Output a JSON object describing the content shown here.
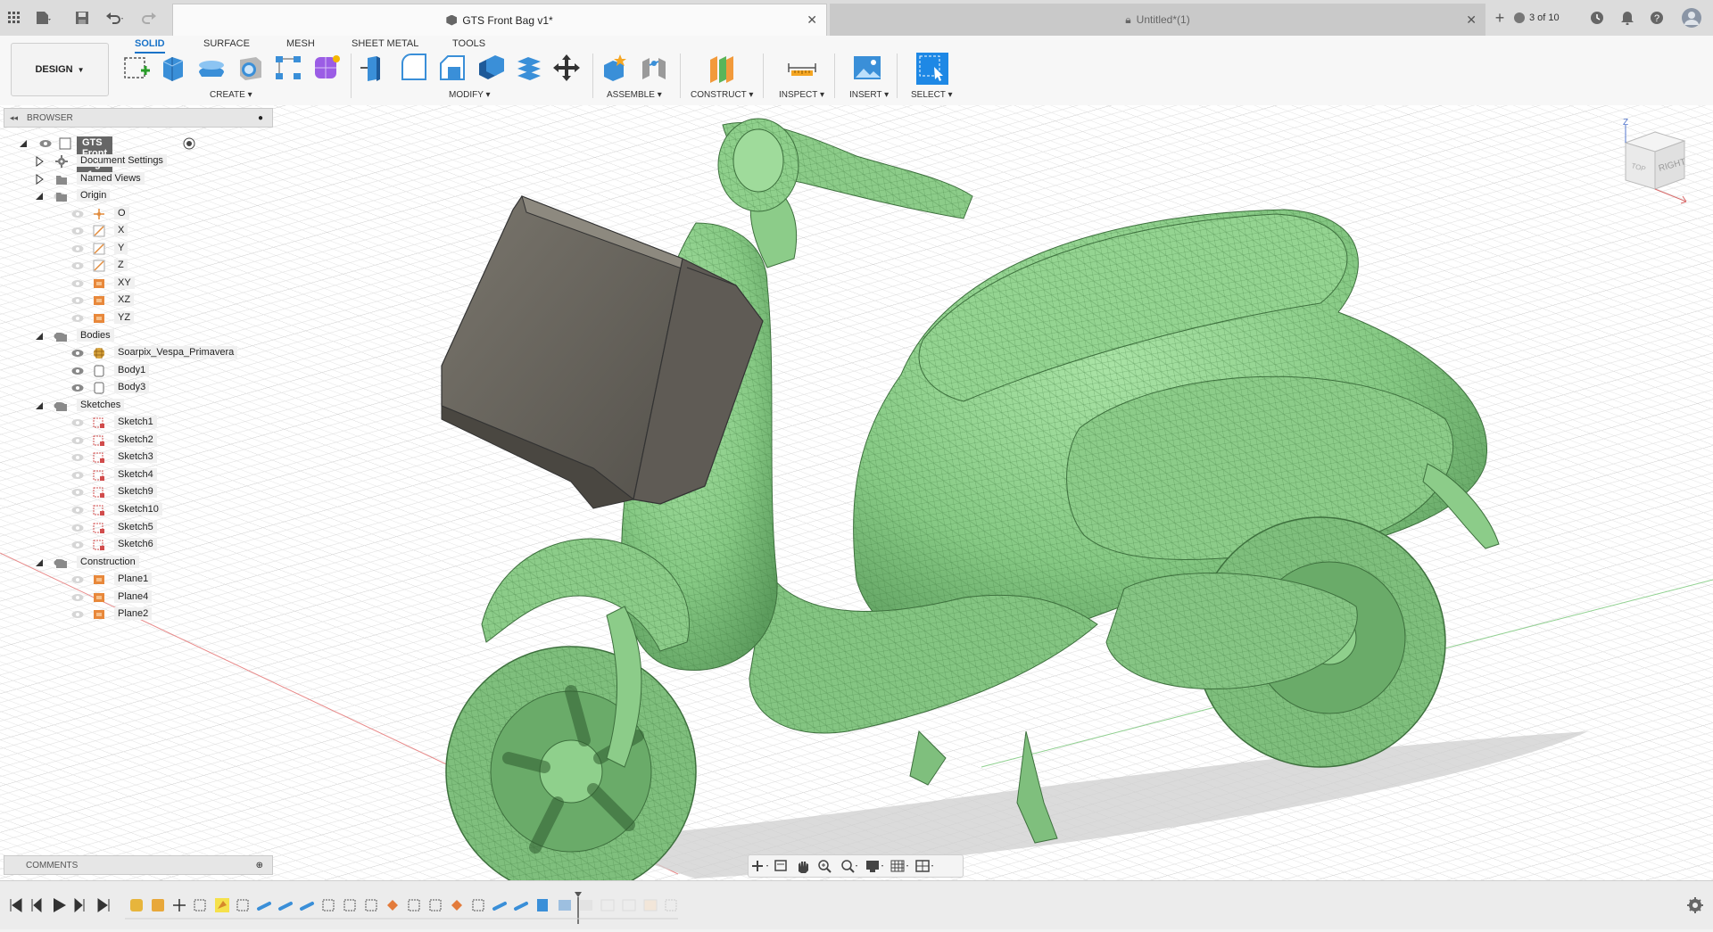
{
  "titlebar": {
    "active_tab": "GTS Front Bag v1*",
    "inactive_tab": "Untitled*(1)",
    "job_status": "3 of 10"
  },
  "ribbon": {
    "workspace": "DESIGN",
    "tabs": [
      "SOLID",
      "SURFACE",
      "MESH",
      "SHEET METAL",
      "TOOLS"
    ],
    "active_tab": "SOLID",
    "groups": [
      "CREATE",
      "MODIFY",
      "ASSEMBLE",
      "CONSTRUCT",
      "INSPECT",
      "INSERT",
      "SELECT"
    ]
  },
  "browser": {
    "title": "BROWSER",
    "root": "GTS Front Bag v1",
    "rows": [
      {
        "label": "Document Settings",
        "icon": "gear-icon"
      },
      {
        "label": "Named Views",
        "icon": "folder-icon"
      },
      {
        "label": "Origin",
        "icon": "folder-icon"
      },
      {
        "label": "O",
        "icon": "origin-point-icon"
      },
      {
        "label": "X",
        "icon": "axis-icon"
      },
      {
        "label": "Y",
        "icon": "axis-icon"
      },
      {
        "label": "Z",
        "icon": "axis-icon"
      },
      {
        "label": "XY",
        "icon": "plane-icon"
      },
      {
        "label": "XZ",
        "icon": "plane-icon"
      },
      {
        "label": "YZ",
        "icon": "plane-icon"
      },
      {
        "label": "Bodies",
        "icon": "folder-icon"
      },
      {
        "label": "Soarpix_Vespa_Primavera",
        "icon": "mesh-body-icon"
      },
      {
        "label": "Body1",
        "icon": "body-icon"
      },
      {
        "label": "Body3",
        "icon": "body-icon"
      },
      {
        "label": "Sketches",
        "icon": "folder-icon"
      },
      {
        "label": "Sketch1",
        "icon": "sketch-icon"
      },
      {
        "label": "Sketch2",
        "icon": "sketch-icon"
      },
      {
        "label": "Sketch3",
        "icon": "sketch-icon"
      },
      {
        "label": "Sketch4",
        "icon": "sketch-icon"
      },
      {
        "label": "Sketch9",
        "icon": "sketch-icon"
      },
      {
        "label": "Sketch10",
        "icon": "sketch-icon"
      },
      {
        "label": "Sketch5",
        "icon": "sketch-icon"
      },
      {
        "label": "Sketch6",
        "icon": "sketch-icon"
      },
      {
        "label": "Construction",
        "icon": "folder-icon"
      },
      {
        "label": "Plane1",
        "icon": "plane-icon"
      },
      {
        "label": "Plane4",
        "icon": "plane-icon"
      },
      {
        "label": "Plane2",
        "icon": "plane-icon"
      }
    ]
  },
  "viewcube": {
    "top": "TOP",
    "right": "RIGHT",
    "axis_z": "Z"
  },
  "comments": {
    "title": "COMMENTS"
  },
  "colors": {
    "accent": "#1a73c8",
    "mesh_green": "#8fd18f",
    "bag_gray": "#6e6a62"
  }
}
